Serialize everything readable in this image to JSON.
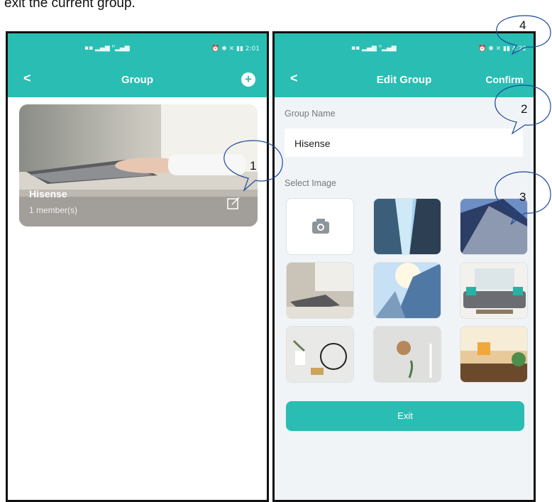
{
  "caption": "exit the current group.",
  "left_screen": {
    "status_time": "2:01",
    "nav": {
      "back": "<",
      "title": "Group",
      "add": "+"
    },
    "group": {
      "name": "Hisense",
      "members": "1 member(s)"
    }
  },
  "right_screen": {
    "status_time": "4:22",
    "nav": {
      "back": "<",
      "title": "Edit Group",
      "confirm": "Confirm"
    },
    "group_name_label": "Group Name",
    "group_name_value": "Hisense",
    "select_image_label": "Select Image",
    "exit_label": "Exit"
  },
  "callouts": [
    "1",
    "2",
    "3",
    "4"
  ],
  "colors": {
    "accent": "#2abdb3",
    "background": "#f1f4f7"
  },
  "icons": [
    "back-icon",
    "add-icon",
    "edit-icon",
    "camera-icon",
    "signal-icon",
    "battery-icon"
  ]
}
